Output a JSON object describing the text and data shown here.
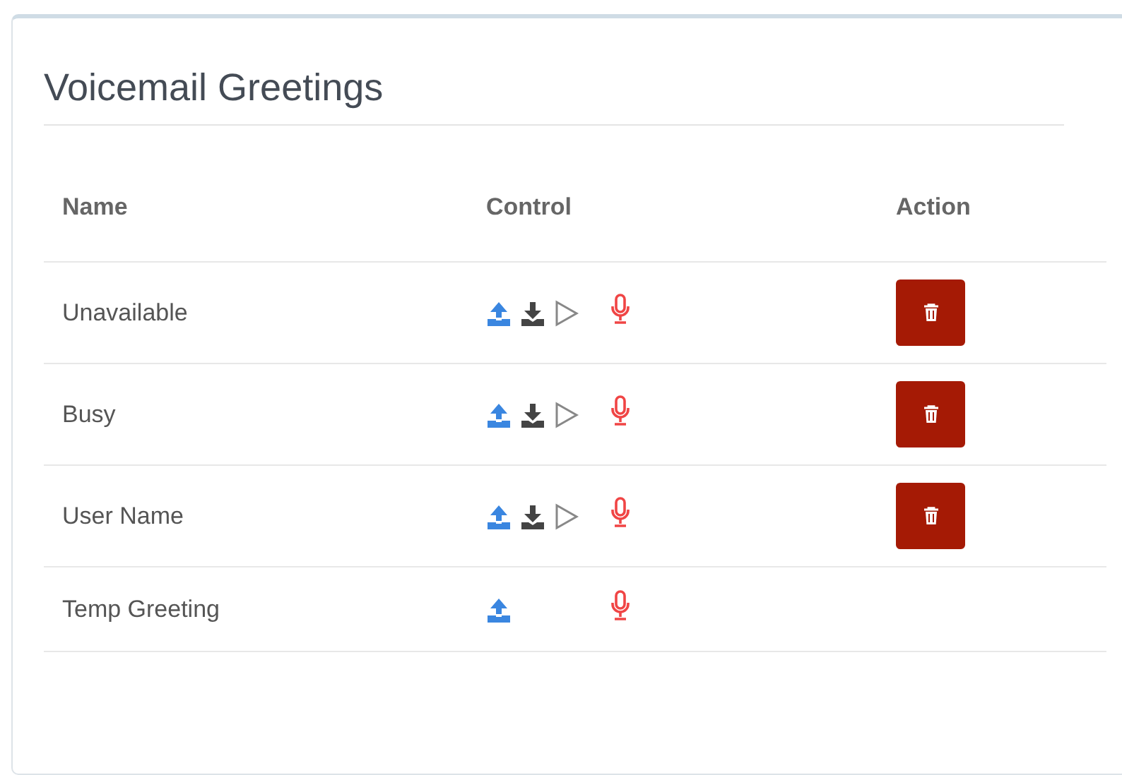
{
  "title": "Voicemail Greetings",
  "columns": [
    "Name",
    "Control",
    "Action"
  ],
  "rows": [
    {
      "name": "Unavailable",
      "recorded": true
    },
    {
      "name": "Busy",
      "recorded": true
    },
    {
      "name": "User Name",
      "recorded": true
    },
    {
      "name": "Temp Greeting",
      "recorded": false
    }
  ]
}
